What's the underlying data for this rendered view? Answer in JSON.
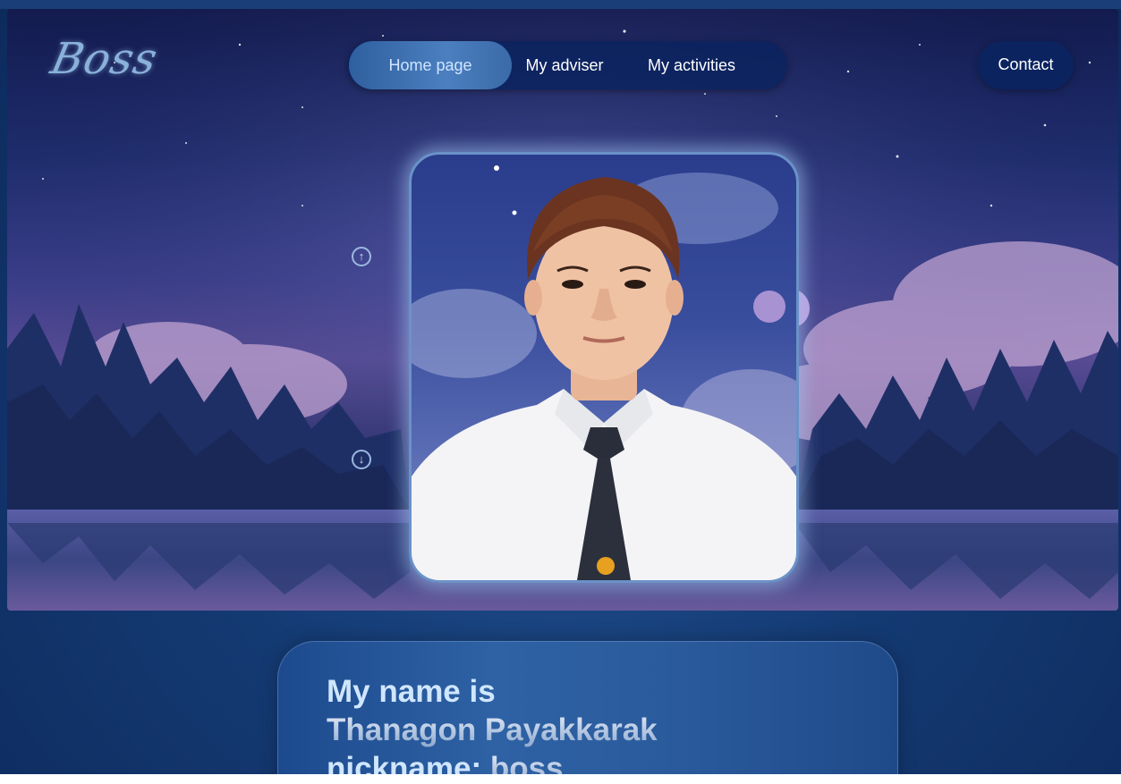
{
  "brand": {
    "logo_text": "Boss"
  },
  "nav": {
    "items": [
      {
        "label": "Home page",
        "active": true
      },
      {
        "label": "My adviser",
        "active": false
      },
      {
        "label": "My activities",
        "active": false
      }
    ],
    "contact_label": "Contact"
  },
  "hero": {
    "scroll_up_icon": "arrow-up-circle-icon",
    "scroll_down_icon": "arrow-down-circle-icon"
  },
  "profile": {
    "intro": "My name is",
    "full_name": "Thanagon Payakkarak",
    "nickname_label": "nickname:",
    "nickname_value": "boss"
  },
  "colors": {
    "page_bg": "#143a73",
    "nav_bg": "#0a235f",
    "nav_active": "#4b7fbf",
    "accent_text": "#cfe6ff"
  }
}
